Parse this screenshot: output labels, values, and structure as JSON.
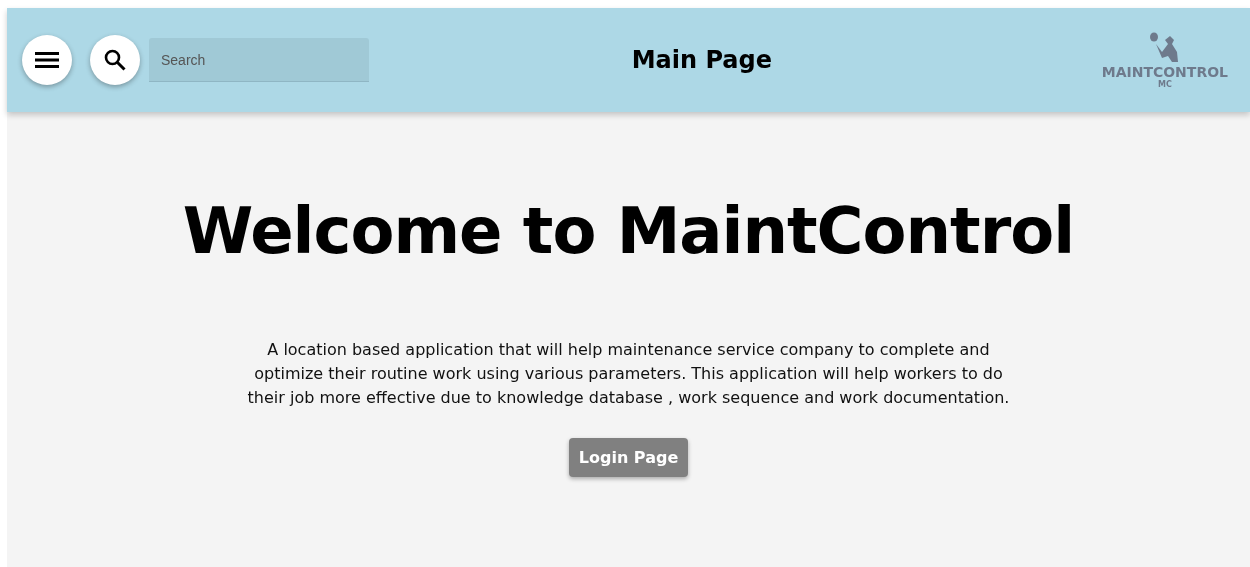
{
  "header": {
    "search": {
      "placeholder": "Search"
    },
    "title": "Main Page",
    "logo": {
      "name": "MAINTCONTROL",
      "initials": "MC"
    }
  },
  "main": {
    "heading": "Welcome to MaintControl",
    "description": "A location based application that will help maintenance service company to complete and optimize their routine work using various parameters. This application will help workers to do their job more effective due to knowledge database , work sequence and work documentation.",
    "button": "Login Page"
  }
}
